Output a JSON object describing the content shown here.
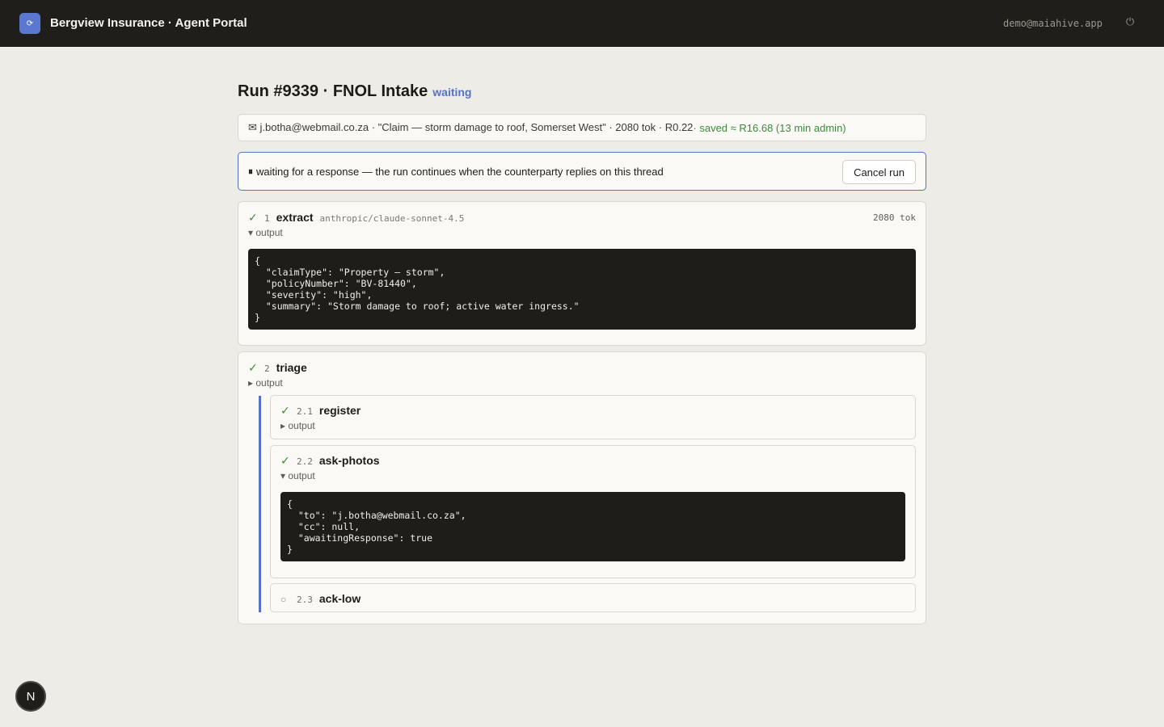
{
  "app": {
    "logo_glyph": "⟳",
    "title": "Bergview Insurance · Agent Portal",
    "user_email": "demo@maiahive.app",
    "power_icon": "⏻"
  },
  "run": {
    "title": "Run #9339 · FNOL Intake",
    "status": "waiting",
    "summary_main": "✉ j.botha@webmail.co.za · \"Claim — storm damage to roof, Somerset West\" · 2080 tok · R0.22",
    "summary_saved": " · saved ≈ R16.68 (13 min admin)",
    "wait_icon": "⏸",
    "wait_message": "waiting for a response — the run continues when the counterparty replies on this thread",
    "cancel_label": "Cancel run"
  },
  "steps": {
    "extract": {
      "check": "✓",
      "num": "1",
      "name": "extract",
      "model": "anthropic/claude-sonnet-4.5",
      "tokens": "2080 tok",
      "toggle": "▾ output",
      "output": "{\n  \"claimType\": \"Property — storm\",\n  \"policyNumber\": \"BV-81440\",\n  \"severity\": \"high\",\n  \"summary\": \"Storm damage to roof; active water ingress.\"\n}"
    },
    "triage": {
      "check": "✓",
      "num": "2",
      "name": "triage",
      "toggle": "▸ output"
    },
    "register": {
      "check": "✓",
      "num": "2.1",
      "name": "register",
      "toggle": "▸ output"
    },
    "ask_photos": {
      "check": "✓",
      "num": "2.2",
      "name": "ask-photos",
      "toggle": "▾ output",
      "output": "{\n  \"to\": \"j.botha@webmail.co.za\",\n  \"cc\": null,\n  \"awaitingResponse\": true\n}"
    },
    "ack_low": {
      "marker": "○",
      "num": "2.3",
      "name": "ack-low"
    }
  },
  "fab_label": "N"
}
